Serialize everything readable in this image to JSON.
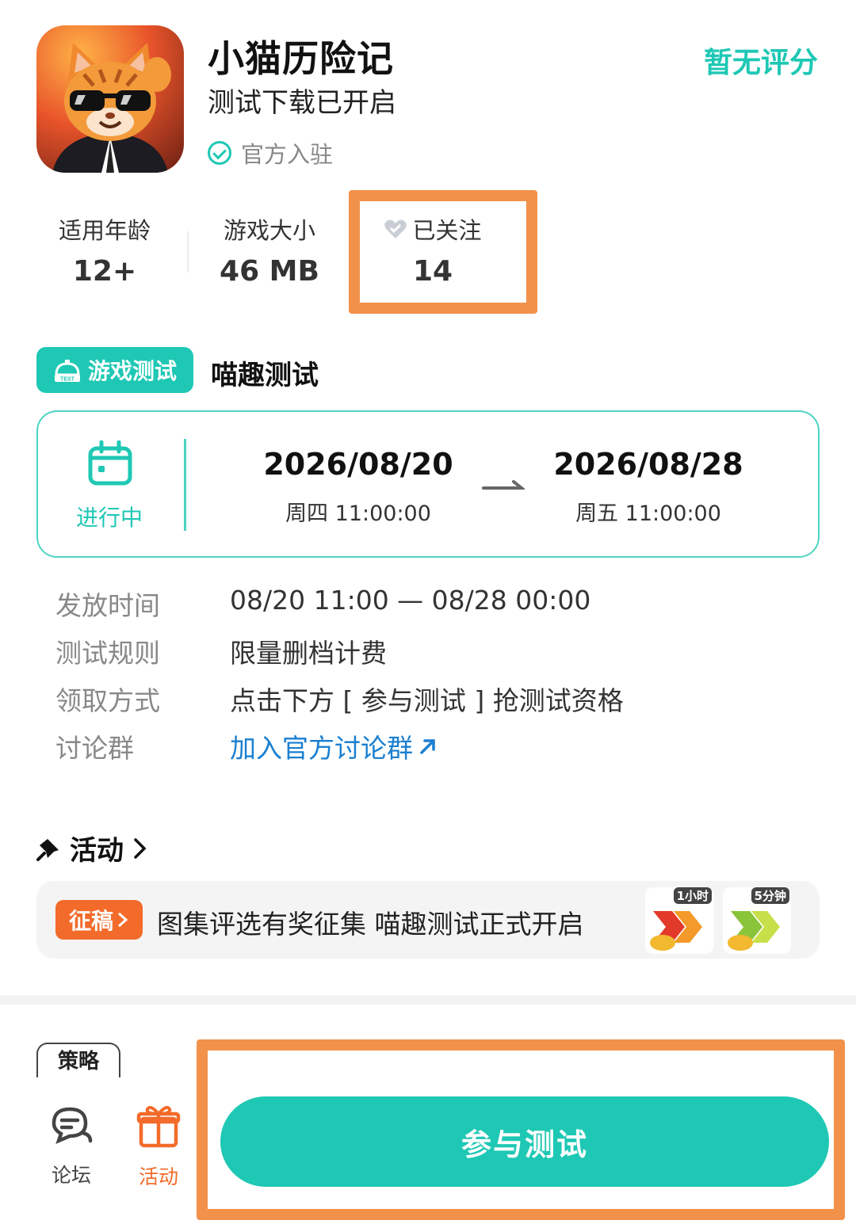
{
  "header": {
    "app_name": "小猫历险记",
    "subtitle": "测试下载已开启",
    "official_label": "官方入驻",
    "rating_text": "暂无评分"
  },
  "stats": [
    {
      "label": "适用年龄",
      "value": "12+"
    },
    {
      "label": "游戏大小",
      "value": "46 MB"
    },
    {
      "label": "已关注",
      "value": "14",
      "icon": "heart-icon"
    }
  ],
  "test": {
    "badge": "游戏测试",
    "name": "喵趣测试",
    "status": "进行中",
    "start": {
      "date": "2026/08/20",
      "time": "周四  11:00:00"
    },
    "end": {
      "date": "2026/08/28",
      "time": "周五  11:00:00"
    }
  },
  "info": [
    {
      "key": "发放时间",
      "value": "08/20 11:00 — 08/28 00:00"
    },
    {
      "key": "测试规则",
      "value": "限量删档计费"
    },
    {
      "key": "领取方式",
      "value": "点击下方 [ 参与测试 ] 抢测试资格"
    },
    {
      "key": "讨论群",
      "value": "加入官方讨论群",
      "is_link": true
    }
  ],
  "activity": {
    "title": "活动",
    "tag": "征稿",
    "text": "图集评选有奖征集 喵趣测试正式开启",
    "thumbs": [
      "1小时",
      "5分钟"
    ]
  },
  "bottom": {
    "strategy_tab": "策略",
    "nav": [
      {
        "label": "论坛",
        "icon": "forum-chat-icon"
      },
      {
        "label": "活动",
        "icon": "gift-icon"
      }
    ],
    "join_button": "参与测试"
  },
  "colors": {
    "accent": "#1ec8b4",
    "link": "#1a7fd0",
    "tag_orange": "#f36b2a",
    "highlight_box": "#f2914a"
  }
}
